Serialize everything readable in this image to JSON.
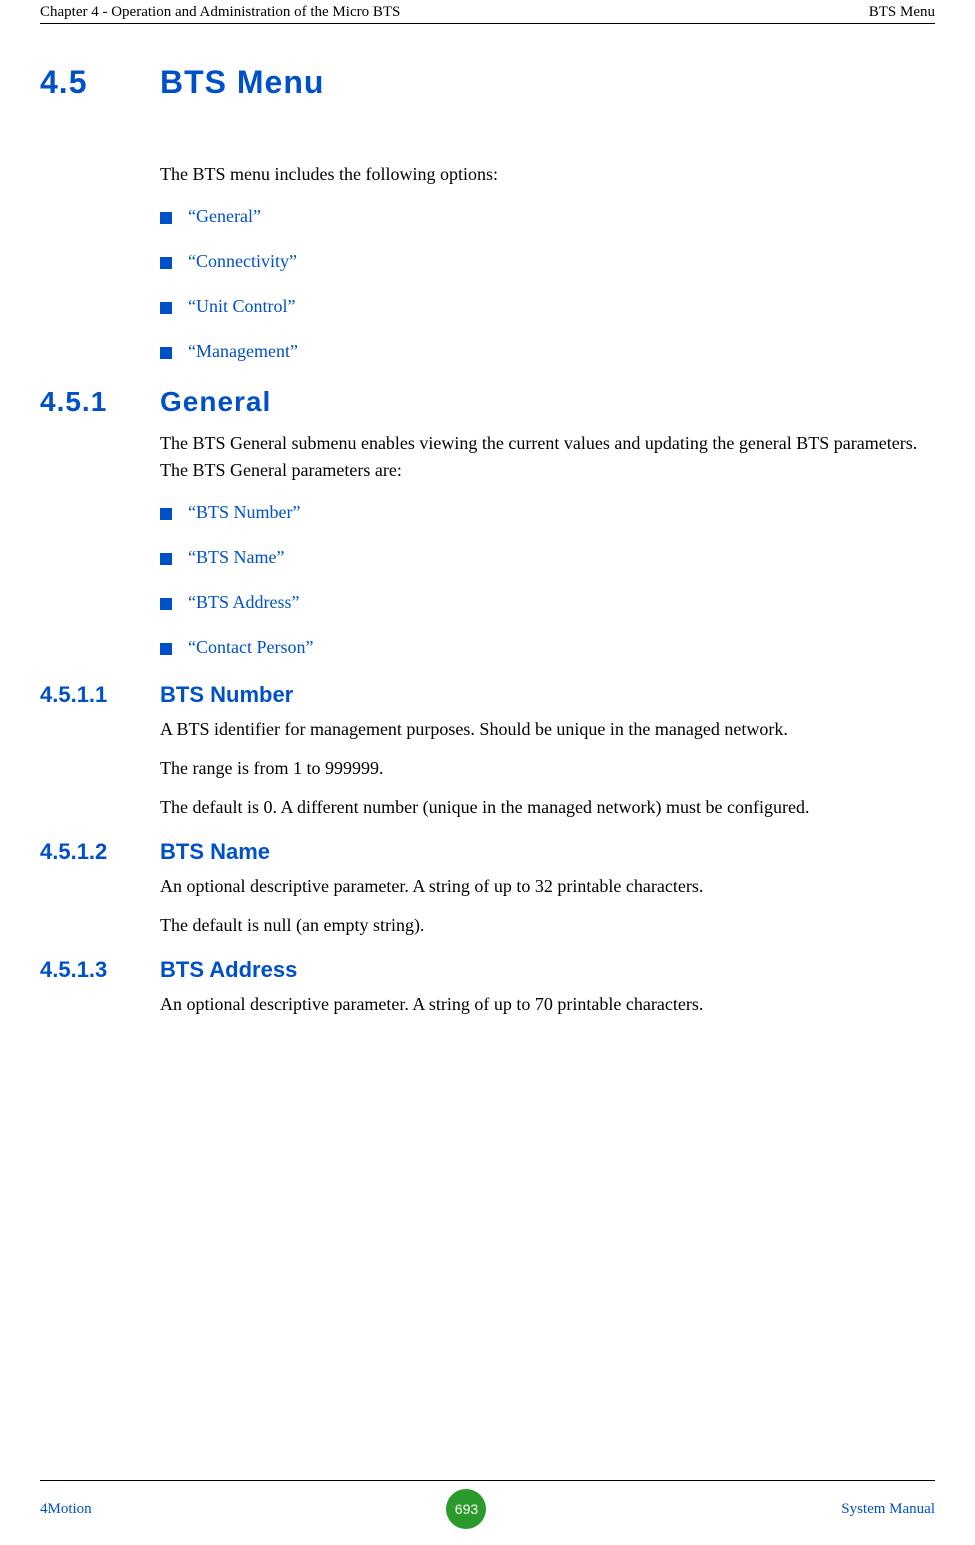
{
  "header": {
    "left": "Chapter 4 - Operation and Administration of the Micro BTS",
    "right": "BTS Menu"
  },
  "s45": {
    "num": "4.5",
    "title": "BTS Menu",
    "intro": "The BTS menu includes the following options:",
    "items": [
      "“General”",
      "“Connectivity”",
      "“Unit Control”",
      "“Management”"
    ]
  },
  "s451": {
    "num": "4.5.1",
    "title": "General",
    "intro": "The BTS General submenu enables viewing the current values and updating the general BTS parameters. The BTS General parameters are:",
    "items": [
      "“BTS Number”",
      "“BTS Name”",
      "“BTS Address”",
      "“Contact Person”"
    ]
  },
  "s4511": {
    "num": "4.5.1.1",
    "title": "BTS Number",
    "p1": "A BTS identifier for management purposes. Should be unique in the managed network.",
    "p2": "The range is from 1 to 999999.",
    "p3": "The default is 0. A different number (unique in the managed network) must be configured."
  },
  "s4512": {
    "num": "4.5.1.2",
    "title": "BTS Name",
    "p1": "An optional descriptive parameter. A string of up to 32 printable characters.",
    "p2": "The default is null (an empty string)."
  },
  "s4513": {
    "num": "4.5.1.3",
    "title": "BTS Address",
    "p1": "An optional descriptive parameter. A string of up to 70 printable characters."
  },
  "footer": {
    "left": "4Motion",
    "page": "693",
    "right": "System Manual"
  }
}
